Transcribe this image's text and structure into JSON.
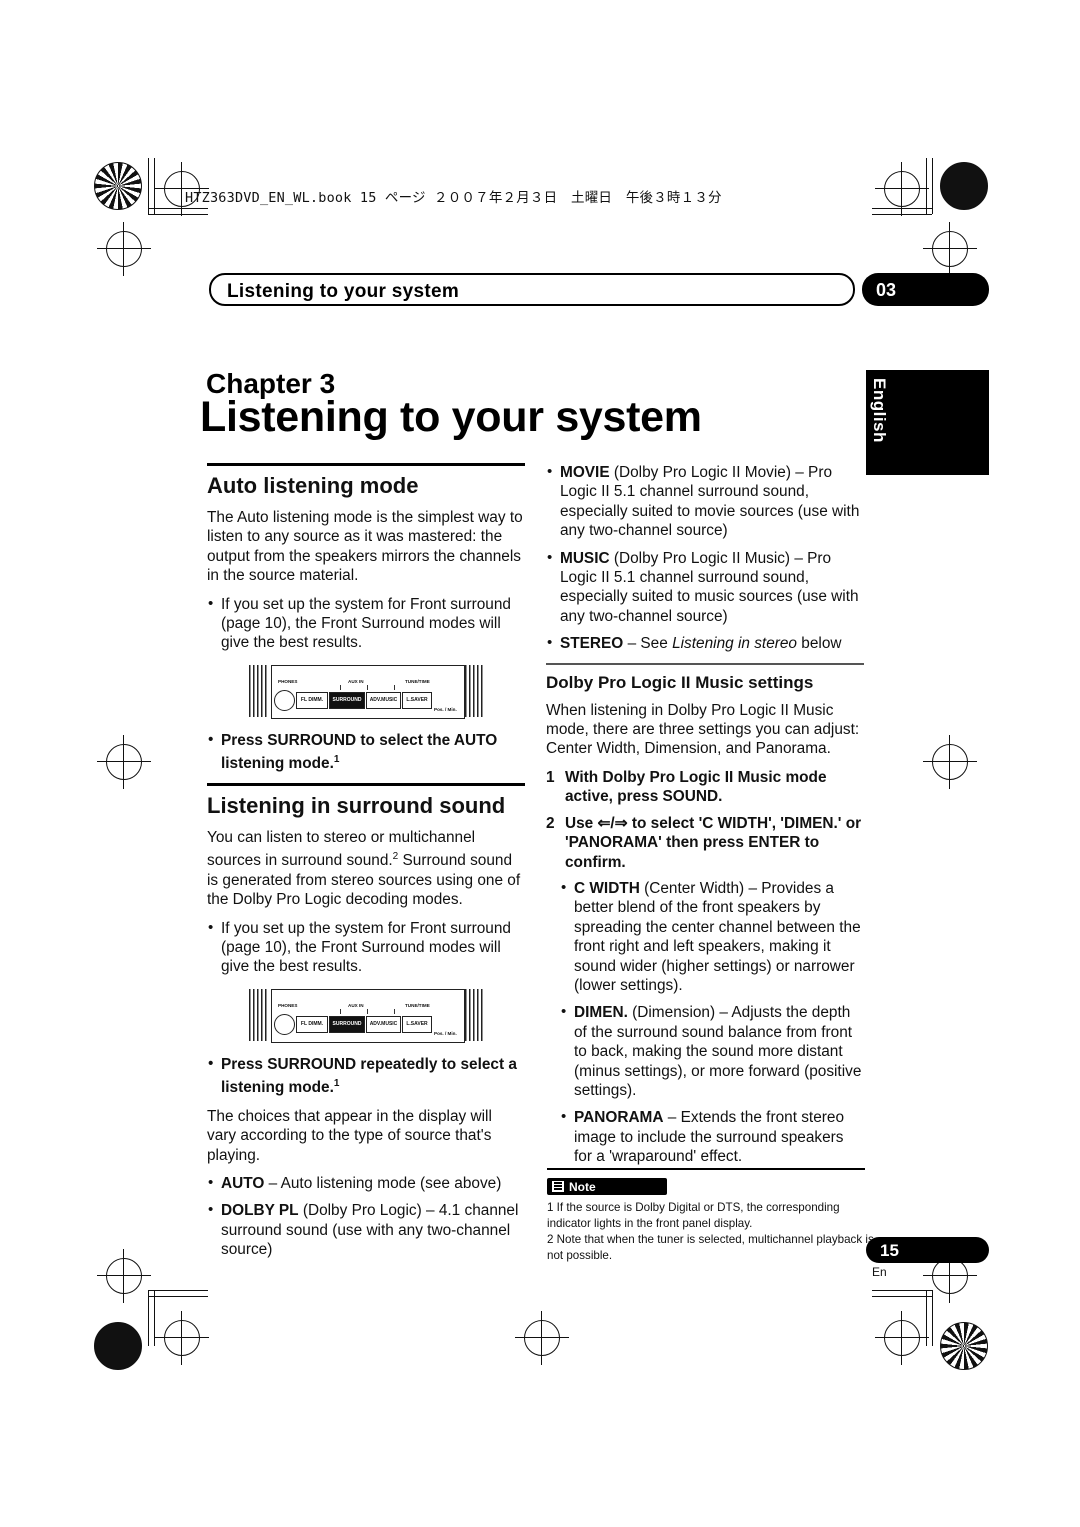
{
  "file_header": "HTZ363DVD_EN_WL.book  15 ページ  ２００７年２月３日　土曜日　午後３時１３分",
  "running_head": "Listening to your system",
  "chapter_number_tab": "03",
  "side_tab": "English",
  "chapter_label": "Chapter  3",
  "chapter_title": "Listening to your system",
  "left_column": {
    "section1_title": "Auto listening mode",
    "section1_body": "The Auto listening mode is the simplest way to listen to any source as it was mastered: the output from the speakers mirrors the channels in the source material.",
    "section1_bullet": "If you set up the system for Front surround (page 10), the Front Surround modes will give the best results.",
    "section1_instruction": "Press SURROUND to select the AUTO listening mode.",
    "section1_instruction_sup": "1",
    "section2_title": "Listening in surround sound",
    "section2_body_a": "You can listen to stereo or multichannel sources in surround sound.",
    "section2_body_sup": "2",
    "section2_body_b": " Surround sound is generated from stereo sources using one of the Dolby Pro Logic decoding modes.",
    "section2_bullet": "If you set up the system for Front surround (page 10), the Front Surround modes will give the best results.",
    "section2_instruction": "Press SURROUND repeatedly to select a listening mode.",
    "section2_instruction_sup": "1",
    "section2_body_c": "The choices that appear in the display will vary according to the type of source that's playing.",
    "mode_list": [
      {
        "name": "AUTO",
        "desc": " – Auto listening mode (see above)"
      },
      {
        "name": "DOLBY PL",
        "desc": " (Dolby Pro Logic) – 4.1 channel surround sound (use with any two-channel source)"
      }
    ]
  },
  "right_column": {
    "mode_list": [
      {
        "name": "MOVIE",
        "desc": " (Dolby Pro Logic II Movie) – Pro Logic II 5.1 channel surround sound, especially suited to movie sources (use with any two-channel source)"
      },
      {
        "name": "MUSIC",
        "desc": " (Dolby Pro Logic II Music) – Pro Logic II 5.1 channel surround sound, especially suited to music sources (use with any two-channel source)"
      }
    ],
    "stereo_name": "STEREO",
    "stereo_desc_a": " – See ",
    "stereo_desc_italic": "Listening in stereo",
    "stereo_desc_b": " below",
    "section_title": "Dolby Pro Logic II Music settings",
    "section_body": "When listening in Dolby Pro Logic II Music mode, there are three settings you can adjust: Center Width, Dimension, and Panorama.",
    "step1_num": "1",
    "step1_text": "With Dolby Pro Logic II Music mode active, press SOUND.",
    "step2_num": "2",
    "step2_text_a": "Use ",
    "step2_arrows": "⇐/⇒",
    "step2_text_b": " to select 'C WIDTH', 'DIMEN.' or 'PANORAMA' then press ENTER to confirm.",
    "settings": [
      {
        "name": "C WIDTH",
        "desc": " (Center Width) –  Provides a better blend of the front speakers by spreading the center channel between the front right and left speakers, making it sound wider (higher settings) or narrower (lower settings)."
      },
      {
        "name": "DIMEN.",
        "desc": " (Dimension) –  Adjusts the depth of the surround sound balance from front to back, making the sound more distant (minus settings), or more forward (positive settings)."
      },
      {
        "name": "PANORAMA",
        "desc": " – Extends the front stereo image to include the surround speakers for a 'wraparound' effect."
      }
    ]
  },
  "note_label": "Note",
  "notes": [
    "1 If the source is Dolby Digital or DTS, the corresponding indicator lights in the front panel display.",
    "2 Note that when the tuner is selected, multichannel playback is not possible."
  ],
  "page_number": "15",
  "page_lang": "En",
  "panel_graphic": {
    "labels_top": [
      "PHONES",
      "AUX IN",
      "TUNE/TIME"
    ],
    "buttons": [
      "FL DIMM.",
      "SURROUND",
      "ADV.MUSIC",
      "L.SAVER"
    ],
    "tuner_label": "Pos. / Min."
  }
}
